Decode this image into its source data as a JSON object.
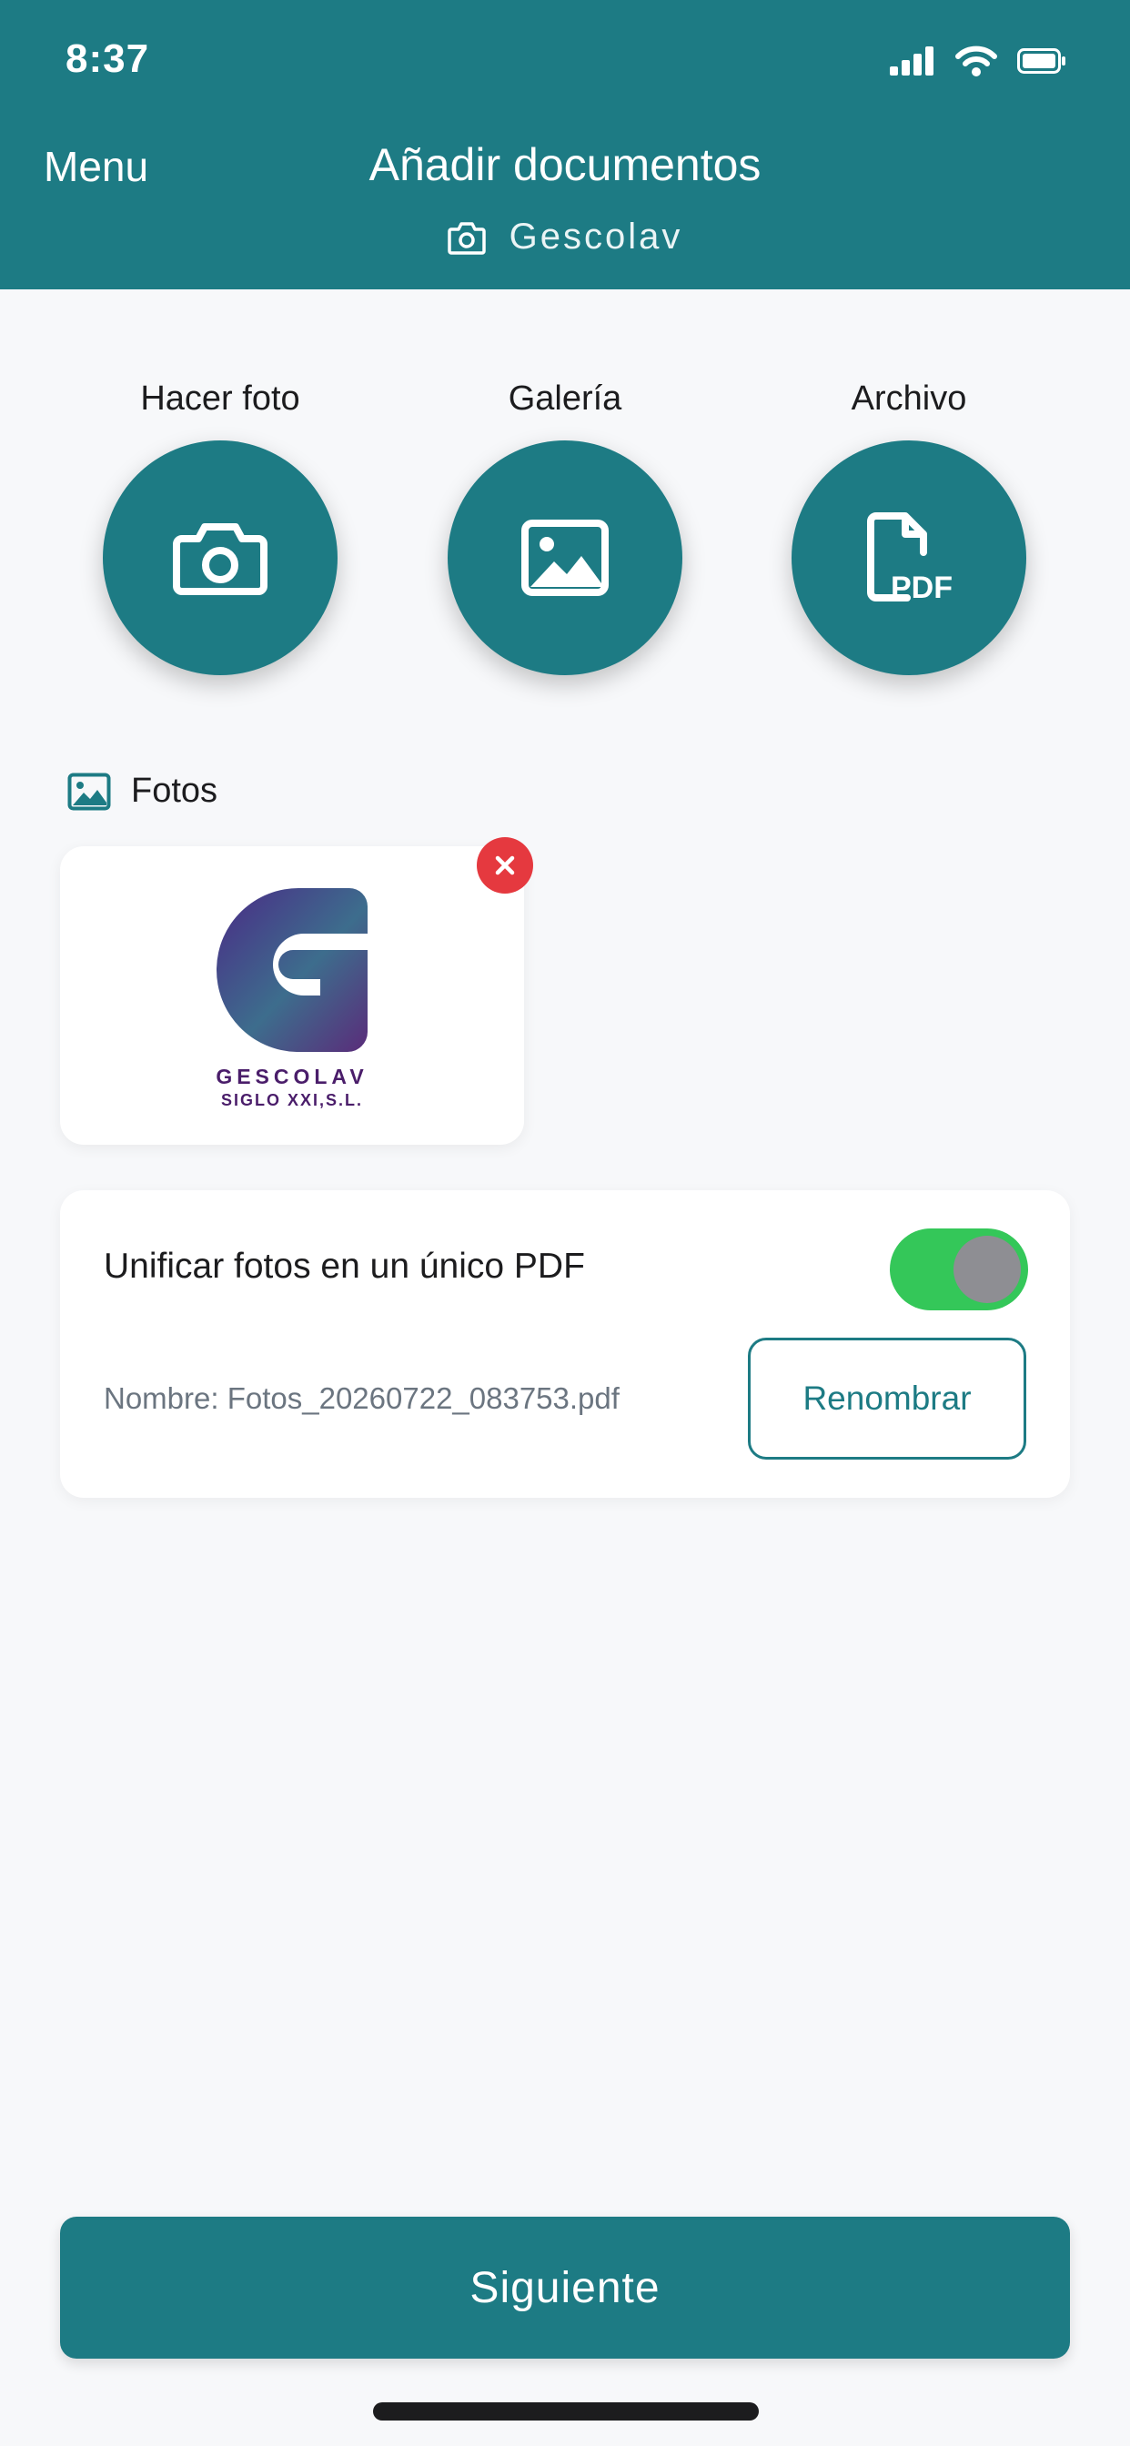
{
  "status_bar": {
    "time": "8:37"
  },
  "header": {
    "menu_label": "Menu",
    "title": "Añadir documentos",
    "subtitle": "Gescolav",
    "subtitle_icon": "camera-icon"
  },
  "actions": [
    {
      "label": "Hacer foto",
      "icon": "camera-icon"
    },
    {
      "label": "Galería",
      "icon": "image-icon"
    },
    {
      "label": "Archivo",
      "icon": "pdf-file-icon"
    }
  ],
  "photos_section": {
    "title": "Fotos",
    "icon": "image-icon",
    "items": [
      {
        "logo_line1": "GESCOLAV",
        "logo_line2": "SIGLO XXI,S.L."
      }
    ]
  },
  "merge_options": {
    "label": "Unificar fotos en un único PDF",
    "toggle_on": true,
    "file_name": "Nombre: Fotos_20260722_083753.pdf",
    "rename_label": "Renombrar"
  },
  "footer": {
    "next_label": "Siguiente"
  },
  "colors": {
    "primary": "#1d7b84",
    "toggle_on": "#34c759",
    "remove": "#e5393f",
    "logo": "#4a1d6a"
  }
}
